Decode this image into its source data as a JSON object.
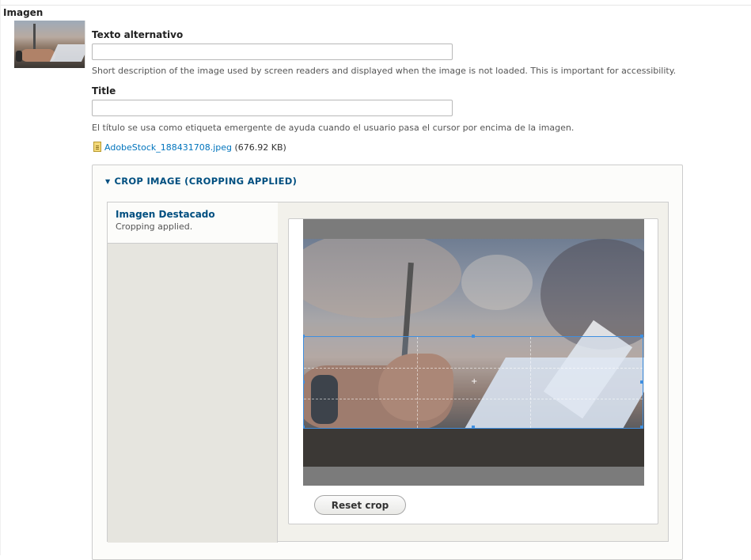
{
  "field": {
    "label": "Imagen"
  },
  "alt": {
    "label": "Texto alternativo",
    "value": "",
    "description": "Short description of the image used by screen readers and displayed when the image is not loaded. This is important for accessibility."
  },
  "title": {
    "label": "Title",
    "value": "",
    "description": "El título se usa como etiqueta emergente de ayuda cuando el usuario pasa el cursor por encima de la imagen."
  },
  "file": {
    "icon": "image-file-icon",
    "name": "AdobeStock_188431708.jpeg",
    "size": "(676.92 KB)"
  },
  "crop": {
    "summary_icon": "triangle-down-icon",
    "summary": "CROP IMAGE (CROPPING APPLIED)",
    "tab": {
      "title": "Imagen Destacado",
      "status": "Cropping applied."
    },
    "reset_label": "Reset crop",
    "crop_box_color": "#3f8fe0"
  },
  "colors": {
    "link": "#0074bd",
    "summary": "#004f80"
  }
}
